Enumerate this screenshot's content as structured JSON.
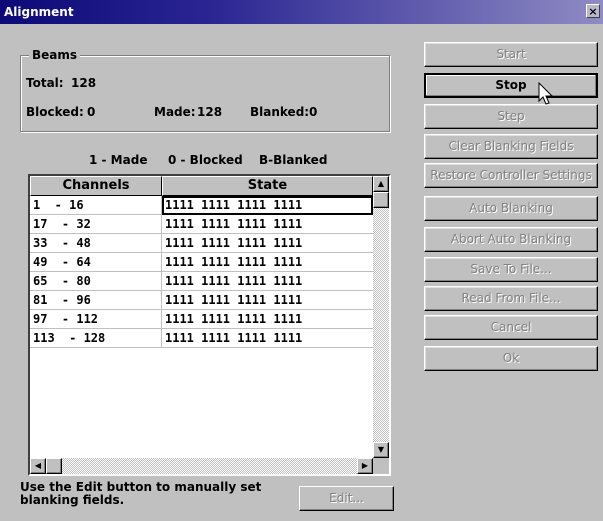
{
  "window": {
    "title": "Alignment",
    "close_glyph": "×"
  },
  "beams": {
    "group_label": "Beams",
    "total_label": "Total:",
    "total_value": "128",
    "blocked_label": "Blocked:",
    "blocked_value": "0",
    "made_label": "Made:",
    "made_value": "128",
    "blanked_label": "Blanked:",
    "blanked_value": "0"
  },
  "legend": {
    "made": "1 - Made",
    "blocked": "0 - Blocked",
    "blanked": "B-Blanked"
  },
  "grid": {
    "headers": [
      "Channels",
      "State"
    ],
    "rows": [
      {
        "channels": "1  - 16",
        "state": "1111 1111 1111 1111"
      },
      {
        "channels": "17  - 32",
        "state": "1111 1111 1111 1111"
      },
      {
        "channels": "33  - 48",
        "state": "1111 1111 1111 1111"
      },
      {
        "channels": "49  - 64",
        "state": "1111 1111 1111 1111"
      },
      {
        "channels": "65  - 80",
        "state": "1111 1111 1111 1111"
      },
      {
        "channels": "81  - 96",
        "state": "1111 1111 1111 1111"
      },
      {
        "channels": "97  - 112",
        "state": "1111 1111 1111 1111"
      },
      {
        "channels": "113  - 128",
        "state": "1111 1111 1111 1111"
      }
    ]
  },
  "note": "Use the Edit button to manually set blanking fields.",
  "edit_button": "Edit...",
  "buttons": {
    "start": "Start",
    "stop": "Stop",
    "step": "Step",
    "clear_blanking": "Clear Blanking Fields",
    "restore_settings": "Restore Controller Settings",
    "auto_blanking": "Auto Blanking",
    "abort_auto_blanking": "Abort Auto Blanking",
    "save_to_file": "Save To File...",
    "read_from_file": "Read From File...",
    "cancel": "Cancel",
    "ok": "Ok"
  },
  "icons": {
    "scroll_up": "up-arrow-icon",
    "scroll_down": "down-arrow-icon",
    "scroll_left": "left-arrow-icon",
    "scroll_right": "right-arrow-icon",
    "cursor": "mouse-pointer-icon",
    "close": "close-icon"
  },
  "colors": {
    "face": "#c0c0c0",
    "title_start": "#0c0a78",
    "title_end": "#8f8bc4",
    "disabled_text": "#808080"
  }
}
